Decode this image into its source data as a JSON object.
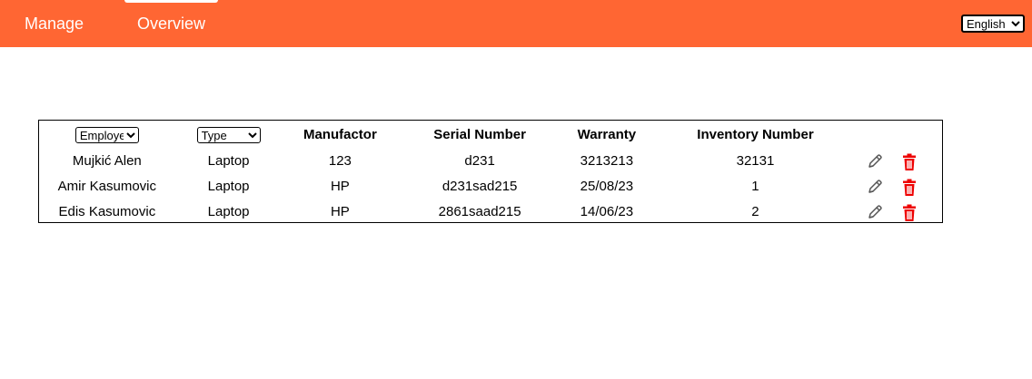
{
  "nav": {
    "manage_label": "Manage",
    "overview_label": "Overview"
  },
  "language": {
    "selected": "English",
    "options": [
      "English"
    ]
  },
  "table": {
    "filters": {
      "employee_selected": "Employee",
      "type_selected": "Type"
    },
    "headers": {
      "manufactor": "Manufactor",
      "serial": "Serial Number",
      "warranty": "Warranty",
      "inventory": "Inventory Number"
    },
    "rows": [
      {
        "employee": "Mujkić Alen",
        "type": "Laptop",
        "manufactor": "123",
        "serial": "d231",
        "warranty": "3213213",
        "inventory": "32131"
      },
      {
        "employee": "Amir Kasumovic",
        "type": "Laptop",
        "manufactor": "HP",
        "serial": "d231sad215",
        "warranty": "25/08/23",
        "inventory": "1"
      },
      {
        "employee": "Edis Kasumovic",
        "type": "Laptop",
        "manufactor": "HP",
        "serial": "2861saad215",
        "warranty": "14/06/23",
        "inventory": "2"
      }
    ]
  },
  "icons": {
    "edit": "pencil-edit-icon",
    "delete": "trash-icon"
  },
  "colors": {
    "navbar": "#ff6633",
    "delete": "#ee0000",
    "edit": "#555555"
  }
}
